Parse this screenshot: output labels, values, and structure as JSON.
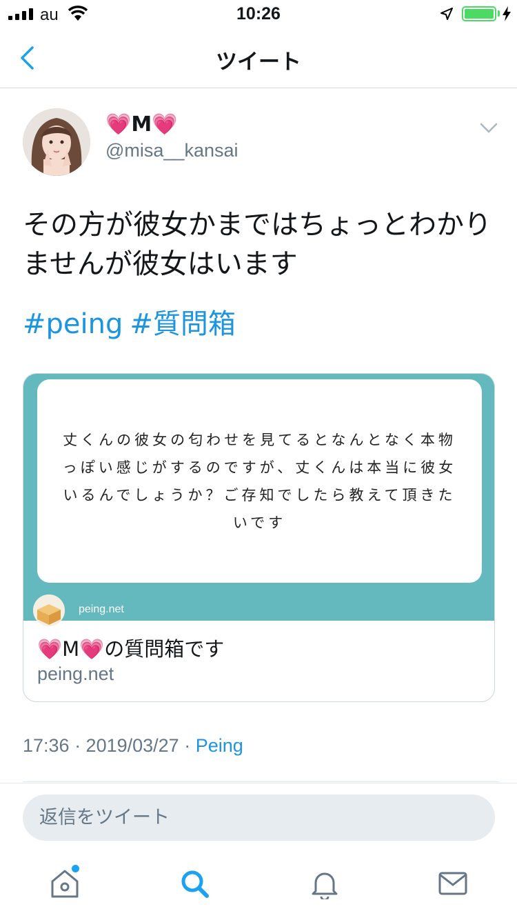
{
  "status_bar": {
    "carrier": "au",
    "time": "10:26",
    "battery_level": 1.0,
    "icons": [
      "signal-icon",
      "wifi-icon",
      "location-arrow-icon",
      "battery-icon",
      "charging-bolt-icon"
    ]
  },
  "nav": {
    "title": "ツイート",
    "back_icon": "chevron-left-icon"
  },
  "tweet": {
    "display_name": "💗M💗",
    "handle": "@misa__kansai",
    "text": "その方が彼女かまではちょっとわかりませんが彼女はいます",
    "hashtags": [
      "#peing",
      "#質問箱"
    ],
    "card": {
      "question": "丈くんの彼女の匂わせを見てるとなんとなく本物っぽい感じがするのですが、丈くんは本当に彼女いるんでしょうか？ご存知でしたら教えて頂きたいです",
      "image_site": "peing.net",
      "title": "💗M💗の質問箱です",
      "domain": "peing.net"
    },
    "timestamp": "17:36 · 2019/03/27 · ",
    "source": "Peing"
  },
  "reply": {
    "placeholder": "返信をツイート"
  },
  "tabbar": {
    "items": [
      "home-icon",
      "search-icon",
      "notifications-icon",
      "messages-icon"
    ],
    "active_color": "#1da1f2",
    "inactive_color": "#657786"
  },
  "colors": {
    "link": "#1b95e0",
    "secondary_text": "#657786",
    "card_teal": "#63b9bd",
    "battery_green": "#4cd964"
  }
}
